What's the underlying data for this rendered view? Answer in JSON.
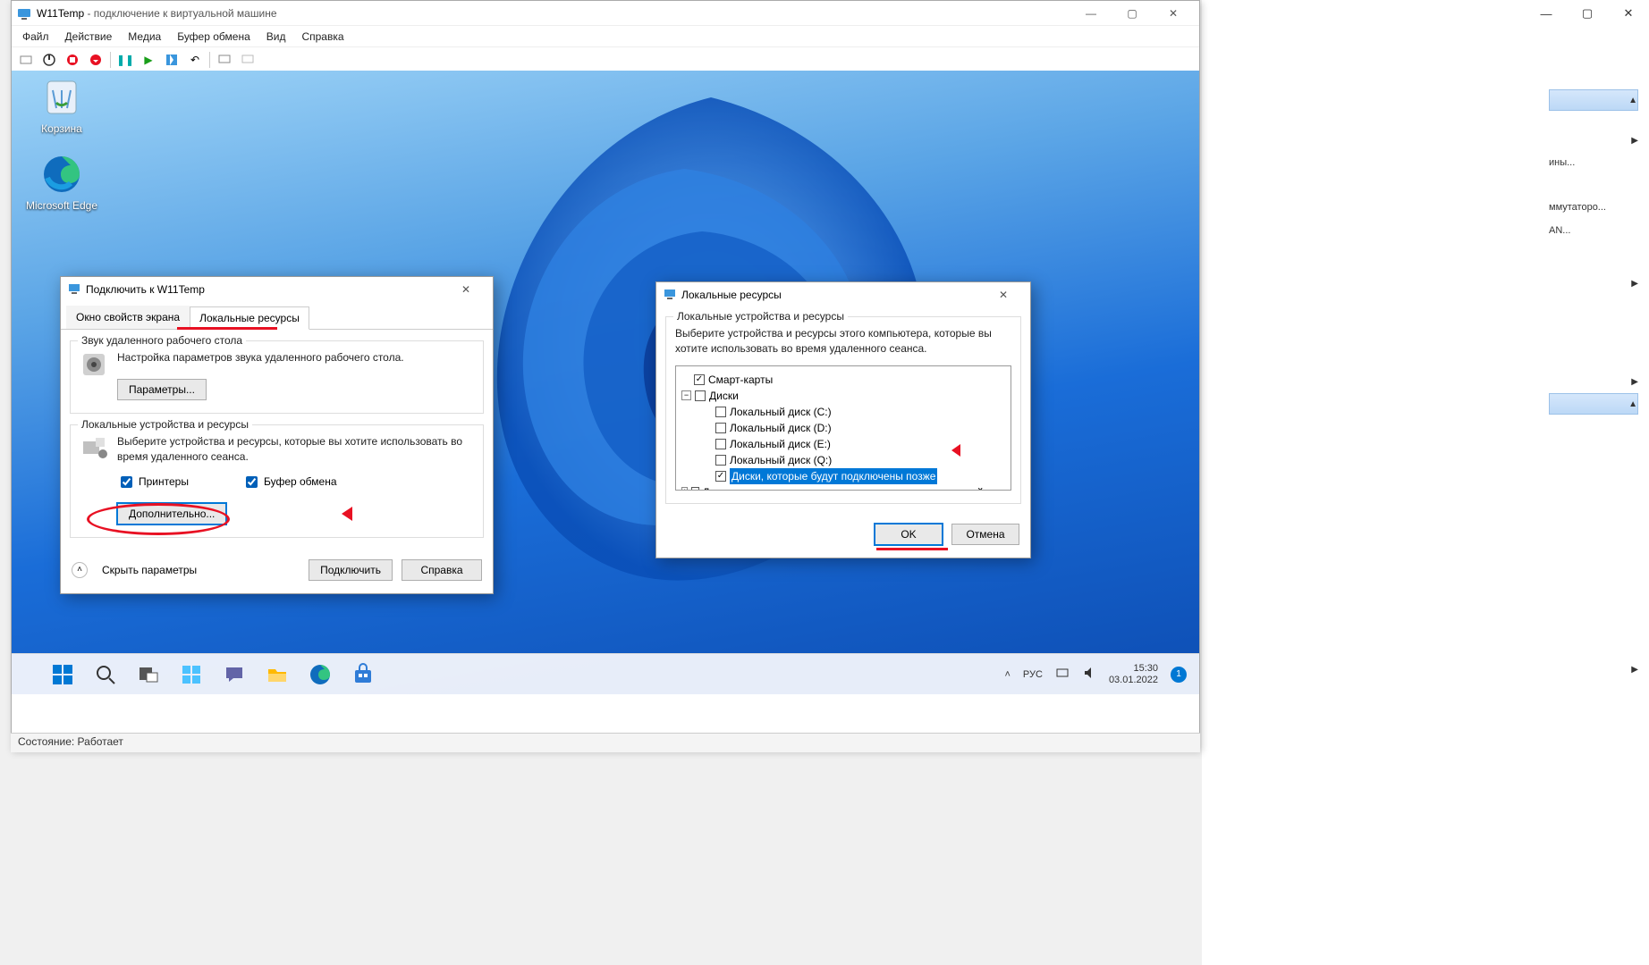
{
  "host": {
    "caption_min": "—",
    "caption_max": "▢",
    "caption_close": "✕",
    "side_items": [
      "ины...",
      "ммутаторо...",
      "AN..."
    ]
  },
  "hv": {
    "title_app": "W11Temp",
    "title_suffix": " - подключение к виртуальной машине",
    "menu": [
      "Файл",
      "Действие",
      "Медиа",
      "Буфер обмена",
      "Вид",
      "Справка"
    ],
    "status": "Состояние: Работает"
  },
  "desktop": {
    "icons": [
      {
        "name": "recycle-bin",
        "label": "Корзина"
      },
      {
        "name": "edge",
        "label": "Microsoft Edge"
      }
    ]
  },
  "rdp": {
    "title": "Подключить к W11Temp",
    "tabs": [
      "Окно свойств экрана",
      "Локальные ресурсы"
    ],
    "active_tab": 1,
    "g1": {
      "legend": "Звук удаленного рабочего стола",
      "text": "Настройка параметров звука удаленного рабочего стола.",
      "btn": "Параметры..."
    },
    "g2": {
      "legend": "Локальные устройства и ресурсы",
      "text": "Выберите устройства и ресурсы, которые вы хотите использовать во время удаленного сеанса.",
      "chk_printers": "Принтеры",
      "chk_clip": "Буфер обмена",
      "btn": "Дополнительно..."
    },
    "hide": "Скрыть параметры",
    "connect": "Подключить",
    "help": "Справка"
  },
  "lr": {
    "title": "Локальные ресурсы",
    "legend": "Локальные устройства и ресурсы",
    "text": "Выберите устройства и ресурсы этого компьютера, которые вы хотите использовать во время удаленного сеанса.",
    "tree": {
      "smart": "Смарт-карты",
      "disks": "Диски",
      "c": "Локальный диск (C:)",
      "d": "Локальный диск (D:)",
      "e": "Локальный диск (E:)",
      "q": "Локальный диск (Q:)",
      "later": "Диски, которые будут подключены позже",
      "other": "Другие поддерживаемые самонастраивающиеся устройства"
    },
    "ok": "OK",
    "cancel": "Отмена"
  },
  "taskbar": {
    "lang": "РУС",
    "time": "15:30",
    "date": "03.01.2022"
  }
}
